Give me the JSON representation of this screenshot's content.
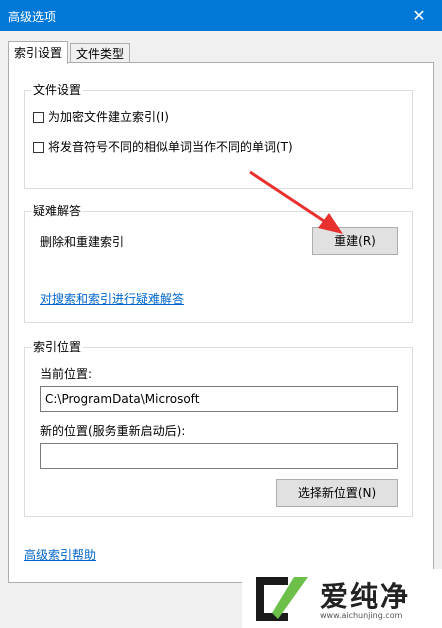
{
  "window": {
    "title": "高级选项",
    "close_glyph": "✕"
  },
  "tabs": [
    {
      "label": "索引设置",
      "active": true
    },
    {
      "label": "文件类型",
      "active": false
    }
  ],
  "file_settings": {
    "title": "文件设置",
    "options": [
      {
        "label": "为加密文件建立索引(I)",
        "checked": false
      },
      {
        "label": "将发音符号不同的相似单词当作不同的单词(T)",
        "checked": false
      }
    ]
  },
  "troubleshoot": {
    "title": "疑难解答",
    "rebuild_label": "删除和重建索引",
    "rebuild_button": "重建(R)",
    "link": "对搜索和索引进行疑难解答"
  },
  "index_location": {
    "title": "索引位置",
    "current_label": "当前位置:",
    "current_value": "C:\\ProgramData\\Microsoft",
    "new_label": "新的位置(服务重新启动后):",
    "new_value": "",
    "select_button": "选择新位置(N)"
  },
  "help_link": "高级索引帮助",
  "watermark": {
    "text": "爱纯净",
    "url": "www.aichunjing.com"
  },
  "colors": {
    "titlebar": "#0078d7",
    "arrow": "#e8312f",
    "link": "#0066cc"
  }
}
